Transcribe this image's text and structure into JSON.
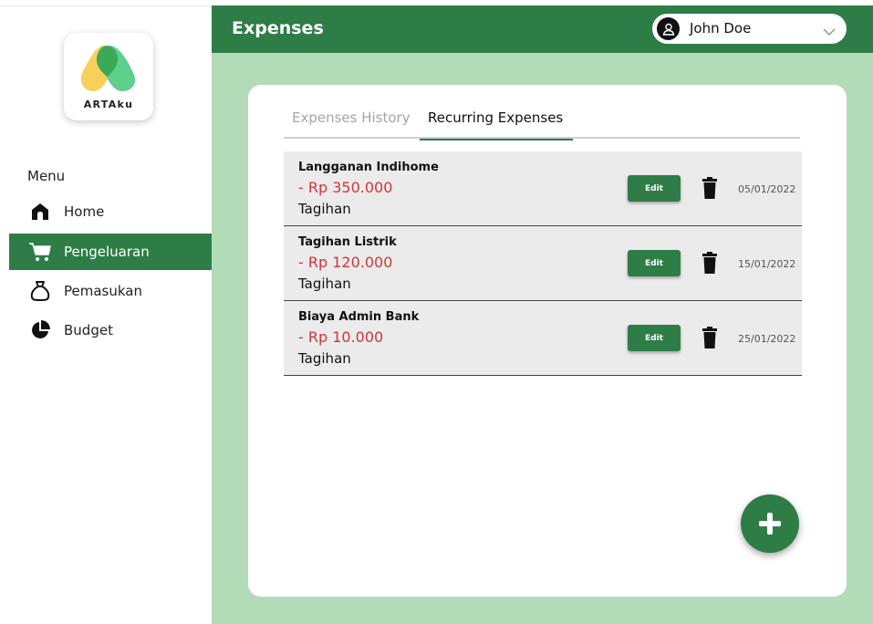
{
  "app": {
    "logo_text": "ARTAku"
  },
  "sidebar": {
    "menu_title": "Menu",
    "items": [
      {
        "label": "Home",
        "icon": "home-icon"
      },
      {
        "label": "Pengeluaran",
        "icon": "cart-icon",
        "active": true
      },
      {
        "label": "Pemasukan",
        "icon": "money-bag-icon"
      },
      {
        "label": "Budget",
        "icon": "pie-chart-icon"
      }
    ]
  },
  "header": {
    "title": "Expenses",
    "user_name": "John Doe"
  },
  "tabs": [
    {
      "label": "Expenses History",
      "active": false
    },
    {
      "label": "Recurring Expenses",
      "active": true
    }
  ],
  "expenses": [
    {
      "name": "Langganan Indihome",
      "amount": "- Rp 350.000",
      "category": "Tagihan",
      "edit_label": "Edit",
      "date": "05/01/2022"
    },
    {
      "name": "Tagihan Listrik",
      "amount": "- Rp 120.000",
      "category": "Tagihan",
      "edit_label": "Edit",
      "date": "15/01/2022"
    },
    {
      "name": "Biaya Admin Bank",
      "amount": "- Rp 10.000",
      "category": "Tagihan",
      "edit_label": "Edit",
      "date": "25/01/2022"
    }
  ],
  "colors": {
    "primary": "#2e7d46",
    "background": "#b2dbb8",
    "negative": "#d0353a"
  }
}
